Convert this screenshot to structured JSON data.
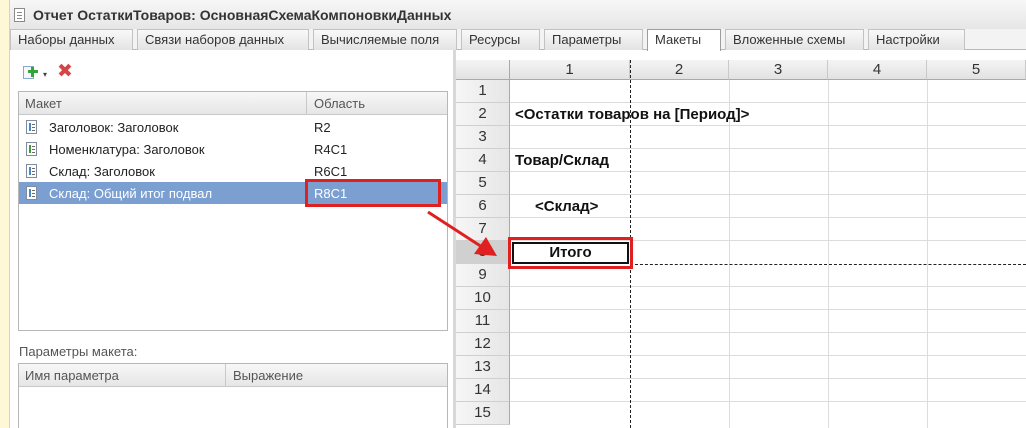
{
  "window": {
    "title": "Отчет ОстаткиТоваров: ОсновнаяСхемаКомпоновкиДанных"
  },
  "tabs": [
    {
      "label": "Наборы данных"
    },
    {
      "label": "Связи наборов данных"
    },
    {
      "label": "Вычисляемые поля"
    },
    {
      "label": "Ресурсы"
    },
    {
      "label": "Параметры"
    },
    {
      "label": "Макеты",
      "active": true
    },
    {
      "label": "Вложенные схемы"
    },
    {
      "label": "Настройки"
    }
  ],
  "toolbar": {
    "add_icon": "add-icon",
    "delete_icon": "delete-icon",
    "dropdown_glyph": "▾",
    "delete_glyph": "✖"
  },
  "layouts_table": {
    "columns": [
      "Макет",
      "Область"
    ],
    "rows": [
      {
        "name": "Заголовок: Заголовок",
        "area": "R2"
      },
      {
        "name": "Номенклатура: Заголовок",
        "area": "R4C1"
      },
      {
        "name": "Склад: Заголовок",
        "area": "R6C1"
      },
      {
        "name": "Склад: Общий итог подвал",
        "area": "R8C1",
        "selected": true
      }
    ]
  },
  "layout_params": {
    "label": "Параметры макета:",
    "columns": [
      "Имя параметра",
      "Выражение"
    ]
  },
  "sheet": {
    "columns": [
      "1",
      "2",
      "3",
      "4",
      "5"
    ],
    "rows": [
      "1",
      "2",
      "3",
      "4",
      "5",
      "6",
      "7",
      "8",
      "9",
      "10",
      "11",
      "12",
      "13",
      "14",
      "15"
    ],
    "active_row": "8",
    "cells": {
      "r2": "<Остатки товаров на [Период]>",
      "r4": "Товар/Склад",
      "r6": "<Склад>",
      "r8": "Итого"
    }
  },
  "colors": {
    "highlight": "#e02020",
    "selection": "#7b9fd0"
  }
}
